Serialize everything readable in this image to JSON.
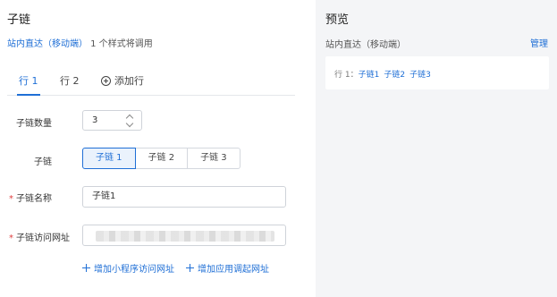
{
  "form": {
    "title": "子链",
    "usage": {
      "link": "站内直达（移动端）",
      "suffix": " 1 个样式将调用"
    },
    "tabs": [
      {
        "label": "行 1",
        "active": true
      },
      {
        "label": "行 2",
        "active": false
      }
    ],
    "add_row_label": "添加行",
    "count": {
      "label": "子链数量",
      "value": "3"
    },
    "sublink": {
      "label": "子链",
      "options": [
        "子链 1",
        "子链 2",
        "子链 3"
      ],
      "selected": "子链 1"
    },
    "name": {
      "label": "子链名称",
      "required_mark": "*",
      "value": "子链1"
    },
    "url": {
      "label": "子链访问网址",
      "required_mark": "*"
    },
    "add_miniprogram_url_label": "增加小程序访问网址",
    "add_app_invoke_url_label": "增加应用调起网址"
  },
  "preview": {
    "title": "预览",
    "subtitle": "站内直达（移动端）",
    "manage_label": "管理",
    "row_prefix": "行 1：",
    "links": [
      "子链1",
      "子链2",
      "子链3"
    ]
  },
  "colors": {
    "accent": "#1f6fd6",
    "required": "#e04040",
    "preview_bg": "#f4f5f7"
  }
}
